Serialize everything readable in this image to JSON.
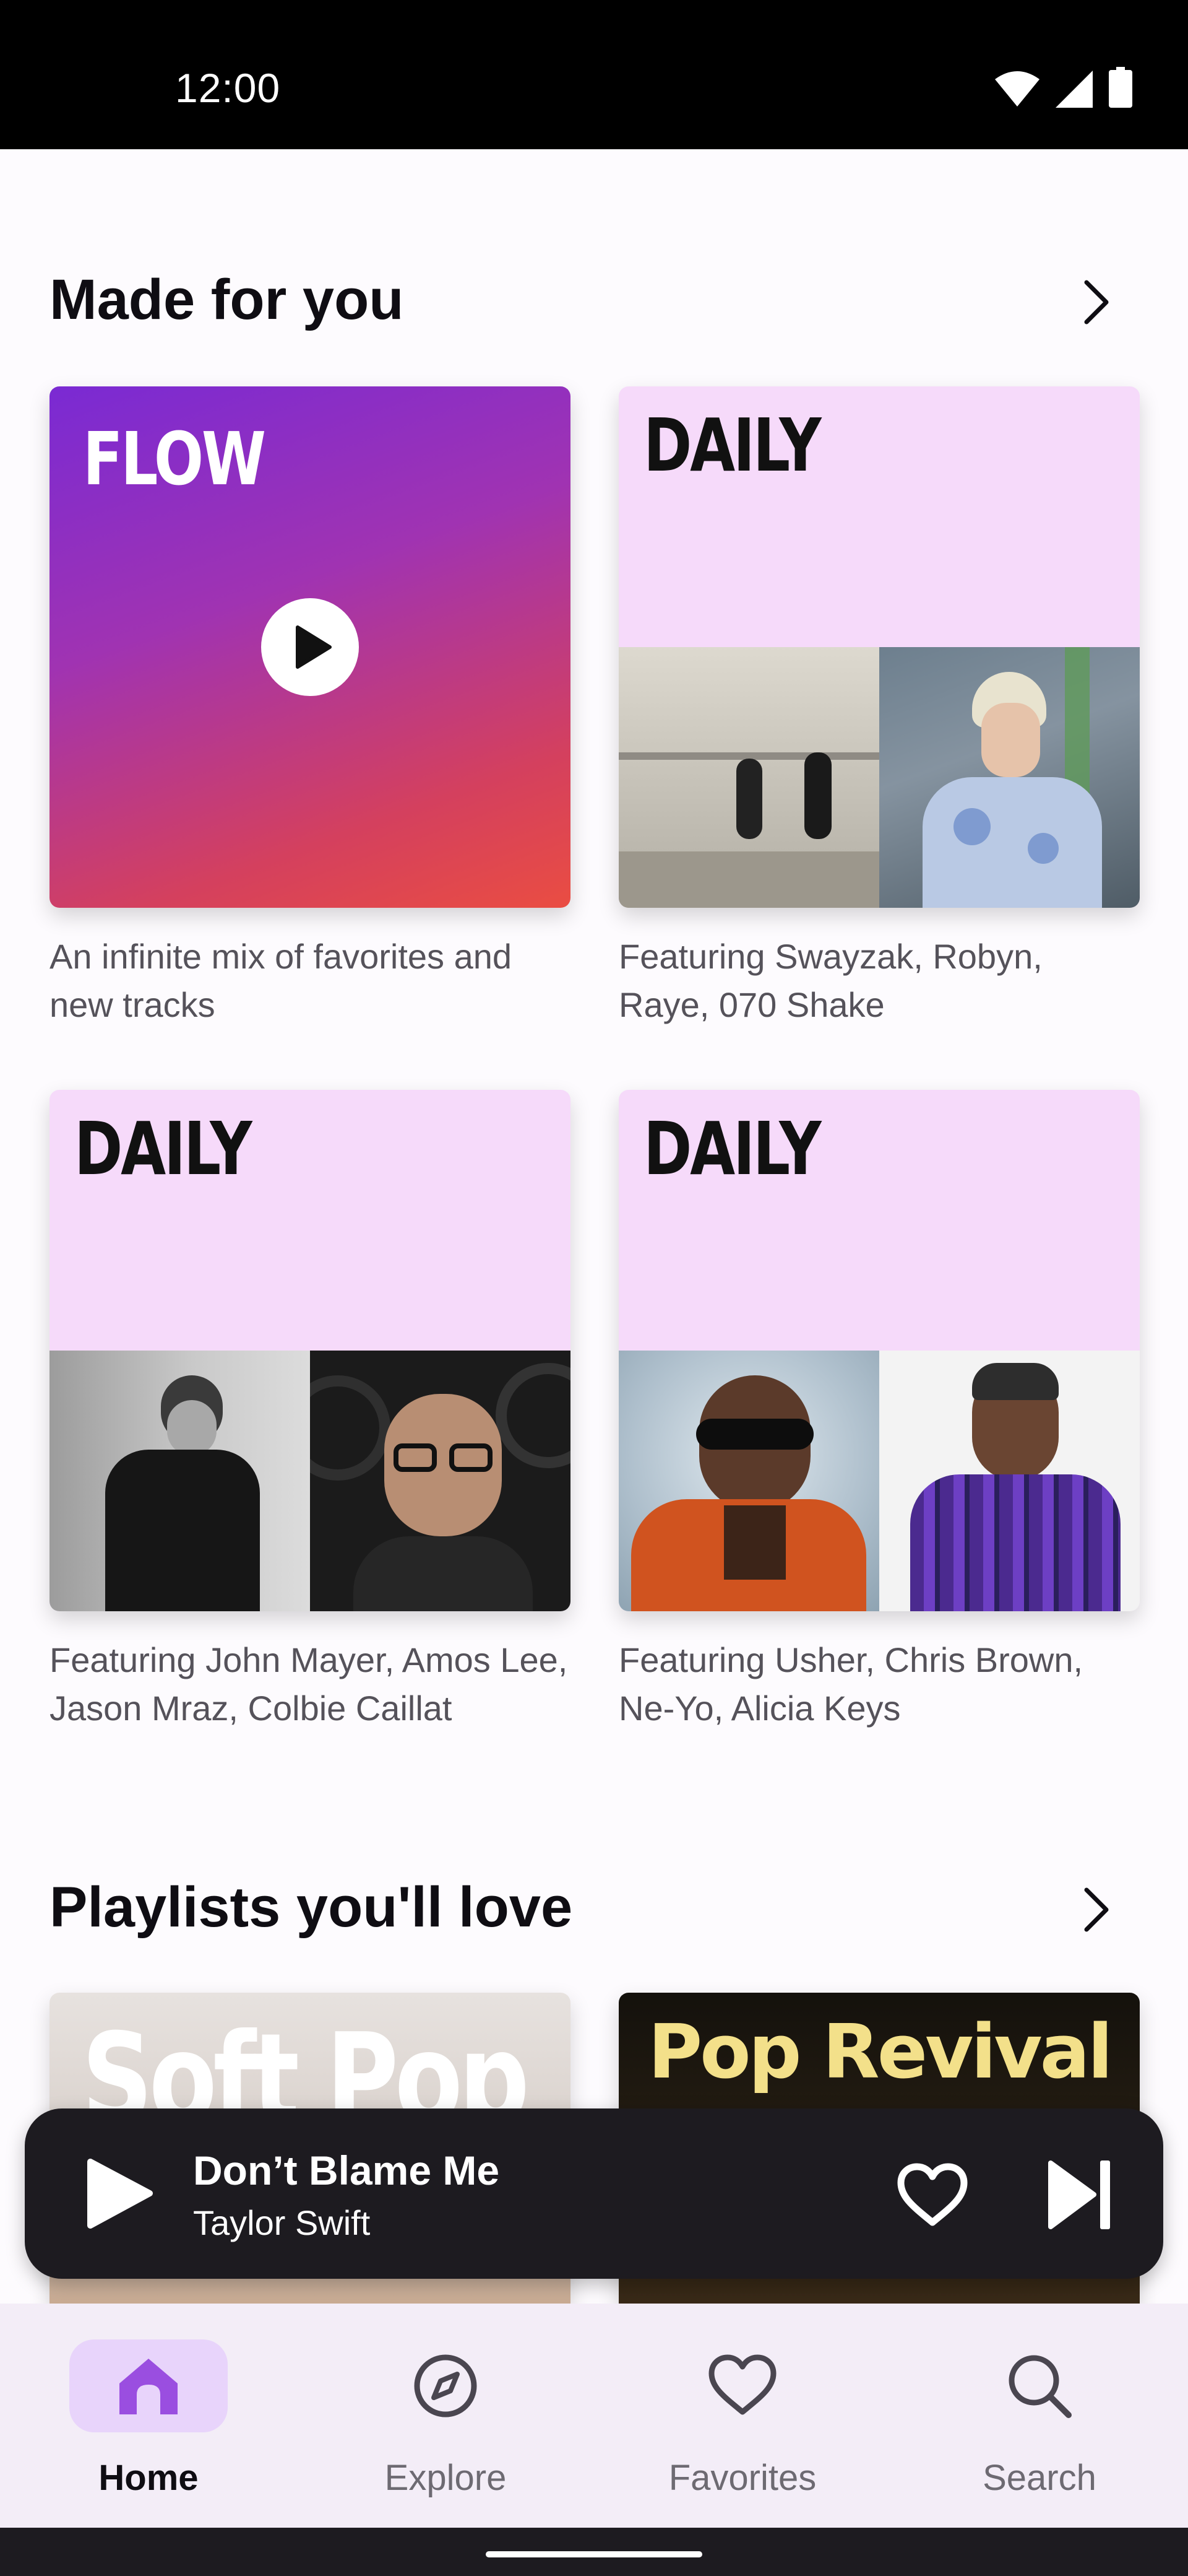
{
  "status_bar": {
    "time": "12:00",
    "icons": [
      "wifi-icon",
      "cellular-icon",
      "battery-icon"
    ]
  },
  "sections": {
    "made_for_you": {
      "title": "Made for you",
      "cards": [
        {
          "label": "FLOW",
          "description": "An infinite mix of favorites and new tracks"
        },
        {
          "label": "DAILY",
          "description": "Featuring Swayzak, Robyn, Raye, 070 Shake"
        },
        {
          "label": "DAILY",
          "description": "Featuring John Mayer, Amos Lee, Jason Mraz, Colbie Caillat"
        },
        {
          "label": "DAILY",
          "description": "Featuring Usher, Chris Brown, Ne-Yo, Alicia Keys"
        }
      ]
    },
    "playlists": {
      "title": "Playlists you'll love",
      "cards": [
        {
          "label": "Soft Pop"
        },
        {
          "label": "Pop Revival"
        }
      ]
    }
  },
  "player": {
    "title": "Don’t Blame Me",
    "artist": "Taylor Swift"
  },
  "bottom_nav": {
    "items": [
      {
        "label": "Home",
        "icon": "home-icon",
        "active": true
      },
      {
        "label": "Explore",
        "icon": "compass-icon",
        "active": false
      },
      {
        "label": "Favorites",
        "icon": "heart-icon",
        "active": false
      },
      {
        "label": "Search",
        "icon": "search-icon",
        "active": false
      }
    ]
  },
  "colors": {
    "accent": "#e8d4fb",
    "home_icon": "#9a4ee0",
    "daily_bg": "#f6dafa",
    "player_bg": "#1d1b20",
    "nav_bg": "#f3edf7"
  }
}
